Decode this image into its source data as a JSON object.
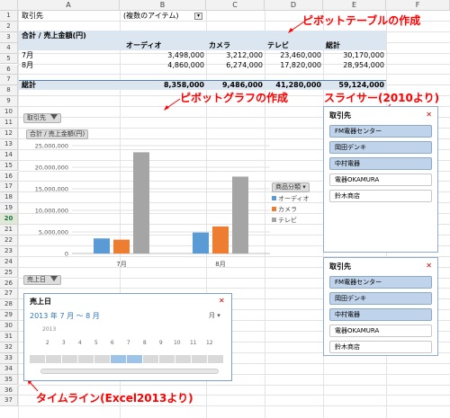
{
  "columns": [
    "A",
    "B",
    "C",
    "D",
    "E",
    "F"
  ],
  "rows": [
    "1",
    "2",
    "3",
    "4",
    "5",
    "6",
    "7",
    "8",
    "9",
    "10",
    "11",
    "12",
    "13",
    "14",
    "15",
    "16",
    "17",
    "18",
    "19",
    "20",
    "21",
    "22",
    "23",
    "24",
    "25",
    "26",
    "27",
    "28",
    "29",
    "30",
    "31",
    "32",
    "33",
    "34",
    "35",
    "36",
    "37"
  ],
  "selected_row": "20",
  "pivot": {
    "filter_label": "取引先",
    "filter_value": "(複数のアイテム)",
    "header_label": "合計 / 売上金額(円)",
    "col_headers": [
      "オーディオ",
      "カメラ",
      "テレビ",
      "総計"
    ],
    "rows": [
      {
        "label": "7月",
        "values": [
          "3,498,000",
          "3,212,000",
          "23,460,000",
          "30,170,000"
        ]
      },
      {
        "label": "8月",
        "values": [
          "4,860,000",
          "6,274,000",
          "17,820,000",
          "28,954,000"
        ]
      }
    ],
    "total": {
      "label": "総計",
      "values": [
        "8,358,000",
        "9,486,000",
        "41,280,000",
        "59,124,000"
      ]
    }
  },
  "annotations": {
    "pivot_table": "ピボットテーブルの作成",
    "pivot_graph": "ピボットグラフの作成",
    "slicer": "スライサー(2010より)",
    "timeline": "タイムライン(Excel2013より)"
  },
  "chart": {
    "filter_btn": "取引先",
    "value_btn": "合計 / 売上金額(円)",
    "axis_btn": "売上日",
    "legend_btn": "商品分類"
  },
  "chart_data": {
    "type": "bar",
    "categories": [
      "7月",
      "8月"
    ],
    "series": [
      {
        "name": "オーディオ",
        "values": [
          3498000,
          4860000
        ],
        "color": "#5b9bd5"
      },
      {
        "name": "カメラ",
        "values": [
          3212000,
          6274000
        ],
        "color": "#ed7d31"
      },
      {
        "name": "テレビ",
        "values": [
          23460000,
          17820000
        ],
        "color": "#a5a5a5"
      }
    ],
    "y_ticks": [
      "0",
      "5,000,000",
      "10,000,000",
      "15,000,000",
      "20,000,000",
      "25,000,000"
    ],
    "ylim": [
      0,
      25000000
    ],
    "legend_position": "right"
  },
  "slicers": [
    {
      "title": "取引先",
      "items": [
        {
          "label": "FM電器センター",
          "selected": true
        },
        {
          "label": "岡田デンキ",
          "selected": true
        },
        {
          "label": "中村電器",
          "selected": true
        },
        {
          "label": "電器OKAMURA",
          "selected": false
        },
        {
          "label": "鈴木商店",
          "selected": false
        }
      ]
    },
    {
      "title": "取引先",
      "items": [
        {
          "label": "FM電器センター",
          "selected": true
        },
        {
          "label": "岡田デンキ",
          "selected": true
        },
        {
          "label": "中村電器",
          "selected": true
        },
        {
          "label": "電器OKAMURA",
          "selected": false
        },
        {
          "label": "鈴木商店",
          "selected": false
        }
      ]
    }
  ],
  "timeline": {
    "title": "売上日",
    "range_label": "2013 年 7 月 ～ 8 月",
    "unit": "月",
    "year": "2013",
    "months": [
      "2",
      "3",
      "4",
      "5",
      "6",
      "7",
      "8",
      "9",
      "10",
      "11",
      "12"
    ],
    "selected_months": [
      "7",
      "8"
    ]
  },
  "colors": {
    "accent_red": "#ff0000",
    "pivot_header": "#dce6f1",
    "slicer_on": "#bfd3ea"
  }
}
